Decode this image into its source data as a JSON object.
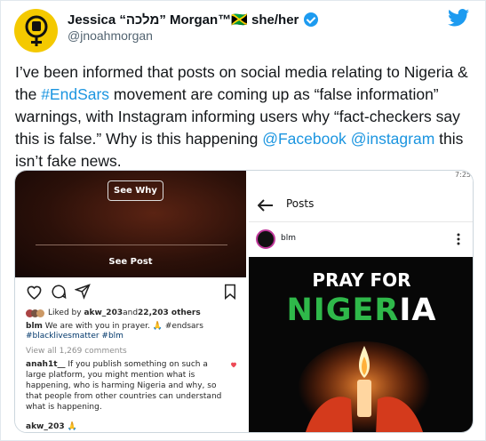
{
  "tweet": {
    "display_name": "Jessica “מלכה” Morgan™🇯🇲 she/her",
    "handle": "@jnoahmorgan",
    "text_1": "I’ve been informed that posts on social media relating to Nigeria & the ",
    "hashtag": "#EndSars",
    "text_2": " movement are coming up as “false information” warnings, with Instagram informing users why “fact-checkers say this is false.” Why is this happening ",
    "mention_1": "@Facebook",
    "text_3": " ",
    "mention_2": "@instagram",
    "text_4": " this isn’t fake news."
  },
  "left_screenshot": {
    "see_why": "See Why",
    "see_post": "See Post",
    "liked_by_prefix": "Liked by ",
    "liked_user": "akw_203",
    "liked_and": " and ",
    "liked_count": "22,203 others",
    "caption_user": "blm",
    "caption_text": " We are with you in prayer. 🙏 #endsars",
    "caption_tags": "#blacklivesmatter #blm",
    "view_comments": "View all 1,269 comments",
    "comment_user": "anah1t__",
    "comment_text": " If you publish something on such a large platform, you might mention what is happening, who is harming Nigeria and why, so that people from other countries can understand what is happening.",
    "comment2_user": "akw_203",
    "comment2_text": "🙏"
  },
  "right_screenshot": {
    "status_time": "7:25",
    "header_title": "Posts",
    "account_name": "blm",
    "pray_line": "PRAY FOR",
    "nigeria_1": "NIGER",
    "nigeria_2": "IA"
  },
  "colors": {
    "link": "#1b95e0",
    "twitter_blue": "#1d9bf0",
    "avatar_yellow": "#f4c900",
    "nigeria_green": "#2fb84a"
  },
  "icons": [
    "venus-fist-icon",
    "verified-badge-icon",
    "twitter-bird-icon",
    "heart-icon",
    "comment-icon",
    "share-icon",
    "bookmark-icon",
    "back-arrow-icon",
    "more-vert-icon"
  ]
}
